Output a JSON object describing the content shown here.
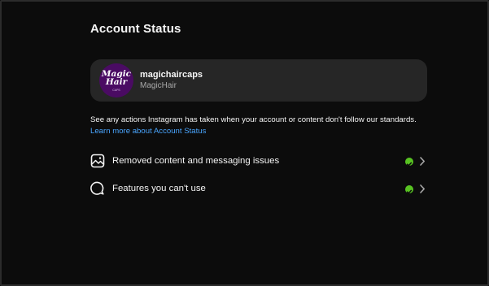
{
  "header": {
    "title": "Account Status"
  },
  "account": {
    "username": "magichaircaps",
    "full_name": "MagicHair",
    "avatar_logo_line1": "Magic",
    "avatar_logo_line2": "Hair",
    "avatar_logo_sub": "CAPS"
  },
  "description": {
    "text": "See any actions Instagram has taken when your account or content don't follow our standards.",
    "link_text": "Learn more about Account Status"
  },
  "status_items": [
    {
      "label": "Removed content and messaging issues",
      "icon": "image-icon",
      "status": "ok"
    },
    {
      "label": "Features you can't use",
      "icon": "chat-bubble-icon",
      "status": "ok"
    }
  ],
  "colors": {
    "background": "#0c0c0c",
    "card": "#262626",
    "text": "#f5f5f5",
    "secondary_text": "#a8a8a8",
    "link": "#4aa6ff",
    "status_ok": "#58c322",
    "avatar_bg": "#4a0b63"
  }
}
